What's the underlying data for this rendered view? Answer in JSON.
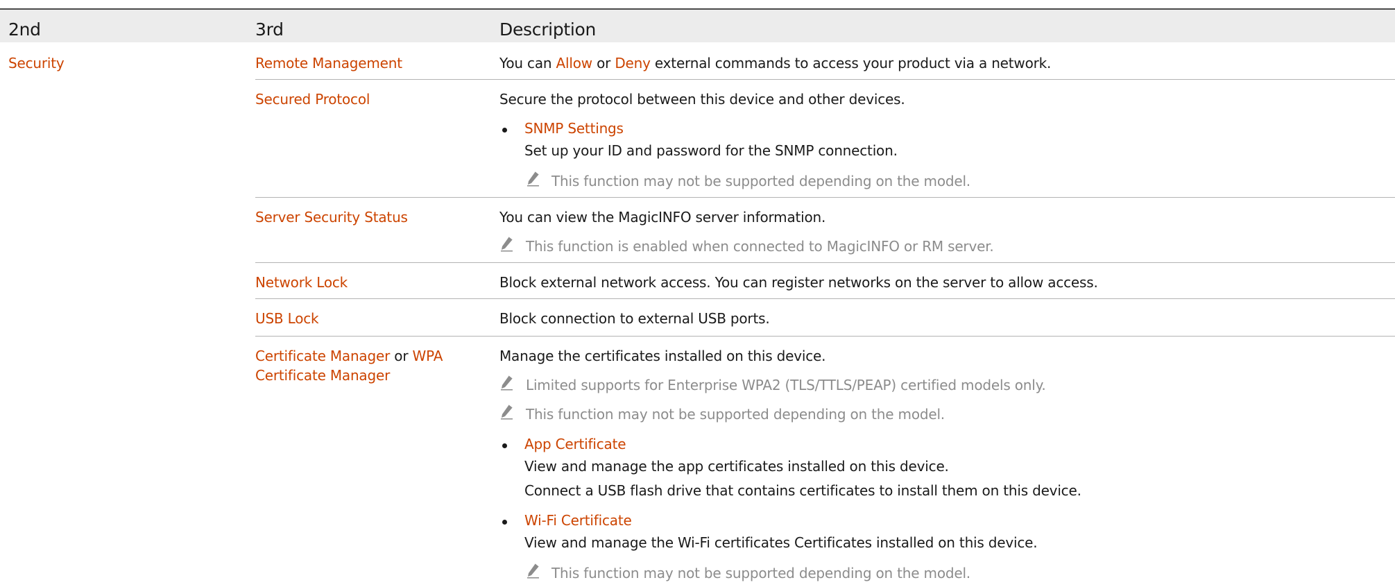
{
  "headers": {
    "col2": "2nd",
    "col3": "3rd",
    "col4": "Description"
  },
  "section": {
    "label": "Security"
  },
  "rows": {
    "remote_management": {
      "label": "Remote Management",
      "desc_pre": "You can",
      "allow": "Allow",
      "or": "or",
      "deny": "Deny",
      "desc_post": "external commands to access your product via a network."
    },
    "secured_protocol": {
      "label": "Secured Protocol",
      "desc": "Secure the protocol between this device and other devices.",
      "snmp_title": "SNMP Settings",
      "snmp_desc": "Set up your ID and password for the SNMP connection.",
      "note": "This function may not be supported depending on the model."
    },
    "server_security": {
      "label": "Server Security Status",
      "desc": "You can view the MagicINFO server information.",
      "note": "This function is enabled when connected to MagicINFO or RM server."
    },
    "network_lock": {
      "label": "Network Lock",
      "desc": "Block external network access. You can register networks on the server to allow access."
    },
    "usb_lock": {
      "label": "USB Lock",
      "desc": "Block connection to external USB ports."
    },
    "certificate_manager": {
      "label_a": "Certificate Manager",
      "label_or": "or",
      "label_b": "WPA",
      "label_c": "Certificate Manager",
      "desc": "Manage the certificates installed on this device.",
      "note1": "Limited supports for Enterprise WPA2 (TLS/TTLS/PEAP) certified models only.",
      "note2": "This function may not be supported depending on the model.",
      "app_title": "App Certificate",
      "app_desc1": "View and manage the app certificates installed on this device.",
      "app_desc2": "Connect a USB flash drive that contains certificates to install them on this device.",
      "wifi_title": "Wi-Fi Certificate",
      "wifi_desc": "View and manage the Wi-Fi certificates Certificates installed on this device.",
      "note3": "This function may not be supported depending on the model."
    }
  },
  "colors": {
    "accent": "#cc4400",
    "header_bg": "#ececec",
    "note_gray": "#8c8c8c",
    "rule": "#b3b3b3"
  },
  "icons": {
    "note": "pencil-note-icon",
    "bullet": "bullet-dot"
  }
}
